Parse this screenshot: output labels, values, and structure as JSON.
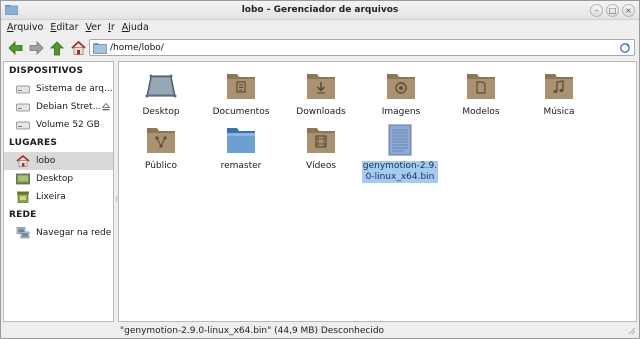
{
  "window": {
    "title": "lobo - Gerenciador de arquivos"
  },
  "menubar": {
    "items": [
      {
        "label": "Arquivo",
        "accel": "A",
        "rest": "rquivo"
      },
      {
        "label": "Editar",
        "accel": "E",
        "rest": "ditar"
      },
      {
        "label": "Ver",
        "accel": "V",
        "rest": "er"
      },
      {
        "label": "Ir",
        "accel": "I",
        "rest": "r"
      },
      {
        "label": "Ajuda",
        "accel": "A",
        "rest": "juda"
      }
    ]
  },
  "address": {
    "value": "/home/lobo/"
  },
  "sidebar": {
    "devices_heading": "DISPOSITIVOS",
    "devices": [
      {
        "label": "Sistema de arq...",
        "icon": "drive-icon"
      },
      {
        "label": "Debian Stret...",
        "icon": "drive-icon"
      },
      {
        "label": "Volume 52 GB",
        "icon": "drive-icon"
      }
    ],
    "places_heading": "LUGARES",
    "places": [
      {
        "label": "lobo",
        "icon": "home-icon"
      },
      {
        "label": "Desktop",
        "icon": "desktop-icon"
      },
      {
        "label": "Lixeira",
        "icon": "trash-icon"
      }
    ],
    "network_heading": "REDE",
    "network": [
      {
        "label": "Navegar na rede",
        "icon": "network-icon"
      }
    ]
  },
  "files": [
    {
      "name": "Desktop",
      "icon": "desktop-folder-icon"
    },
    {
      "name": "Documentos",
      "icon": "documents-folder-icon"
    },
    {
      "name": "Downloads",
      "icon": "downloads-folder-icon"
    },
    {
      "name": "Imagens",
      "icon": "pictures-folder-icon"
    },
    {
      "name": "Modelos",
      "icon": "templates-folder-icon"
    },
    {
      "name": "Música",
      "icon": "music-folder-icon"
    },
    {
      "name": "Público",
      "icon": "public-folder-icon"
    },
    {
      "name": "remaster",
      "icon": "folder-icon"
    },
    {
      "name": "Vídeos",
      "icon": "videos-folder-icon"
    },
    {
      "name_line1": "genymotion-2.9.",
      "name_line2": "0-linux_x64.bin",
      "icon": "binary-file-icon",
      "selected": true
    }
  ],
  "status": {
    "text": "\"genymotion-2.9.0-linux_x64.bin\" (44,9 MB) Desconhecido"
  },
  "colors": {
    "folder": "#a08a6b",
    "folder_light": "#bfa987",
    "selection": "#a7cbf0",
    "sidebar_selected": "#d9d9d9"
  }
}
